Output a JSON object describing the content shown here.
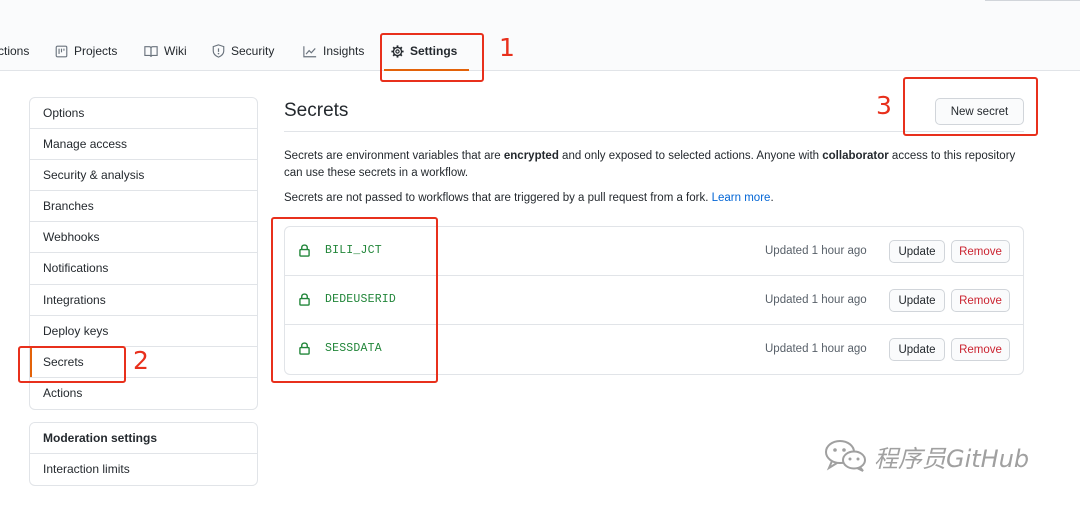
{
  "tabs": [
    {
      "label": "ctions",
      "icon": "play-icon"
    },
    {
      "label": "Projects",
      "icon": "project-board-icon"
    },
    {
      "label": "Wiki",
      "icon": "book-icon"
    },
    {
      "label": "Security",
      "icon": "shield-icon"
    },
    {
      "label": "Insights",
      "icon": "graph-icon"
    },
    {
      "label": "Settings",
      "icon": "gear-icon",
      "active": true
    }
  ],
  "sidebar": {
    "items": [
      {
        "label": "Options"
      },
      {
        "label": "Manage access"
      },
      {
        "label": "Security & analysis"
      },
      {
        "label": "Branches"
      },
      {
        "label": "Webhooks"
      },
      {
        "label": "Notifications"
      },
      {
        "label": "Integrations"
      },
      {
        "label": "Deploy keys"
      },
      {
        "label": "Secrets",
        "selected": true
      },
      {
        "label": "Actions"
      }
    ],
    "moderation": {
      "heading": "Moderation settings",
      "items": [
        {
          "label": "Interaction limits"
        }
      ]
    }
  },
  "main": {
    "title": "Secrets",
    "new_secret_label": "New secret",
    "desc1_a": "Secrets are environment variables that are ",
    "desc1_b": "encrypted",
    "desc1_c": " and only exposed to selected actions. Anyone with ",
    "desc1_d": "collaborator",
    "desc1_e": " access to this repository can use these secrets in a workflow.",
    "desc2_a": "Secrets are not passed to workflows that are triggered by a pull request from a fork. ",
    "desc2_link": "Learn more",
    "desc2_end": ".",
    "secrets": [
      {
        "name": "BILI_JCT",
        "updated": "Updated 1 hour ago",
        "update_label": "Update",
        "remove_label": "Remove"
      },
      {
        "name": "DEDEUSERID",
        "updated": "Updated 1 hour ago",
        "update_label": "Update",
        "remove_label": "Remove"
      },
      {
        "name": "SESSDATA",
        "updated": "Updated 1 hour ago",
        "update_label": "Update",
        "remove_label": "Remove"
      }
    ]
  },
  "annotations": [
    "1",
    "2",
    "3"
  ],
  "watermark": "程序员GitHub",
  "colors": {
    "accent": "#e36209",
    "annotation": "#e8301c",
    "secret_name": "#22863a",
    "danger": "#cb2431",
    "link": "#0366d6"
  }
}
